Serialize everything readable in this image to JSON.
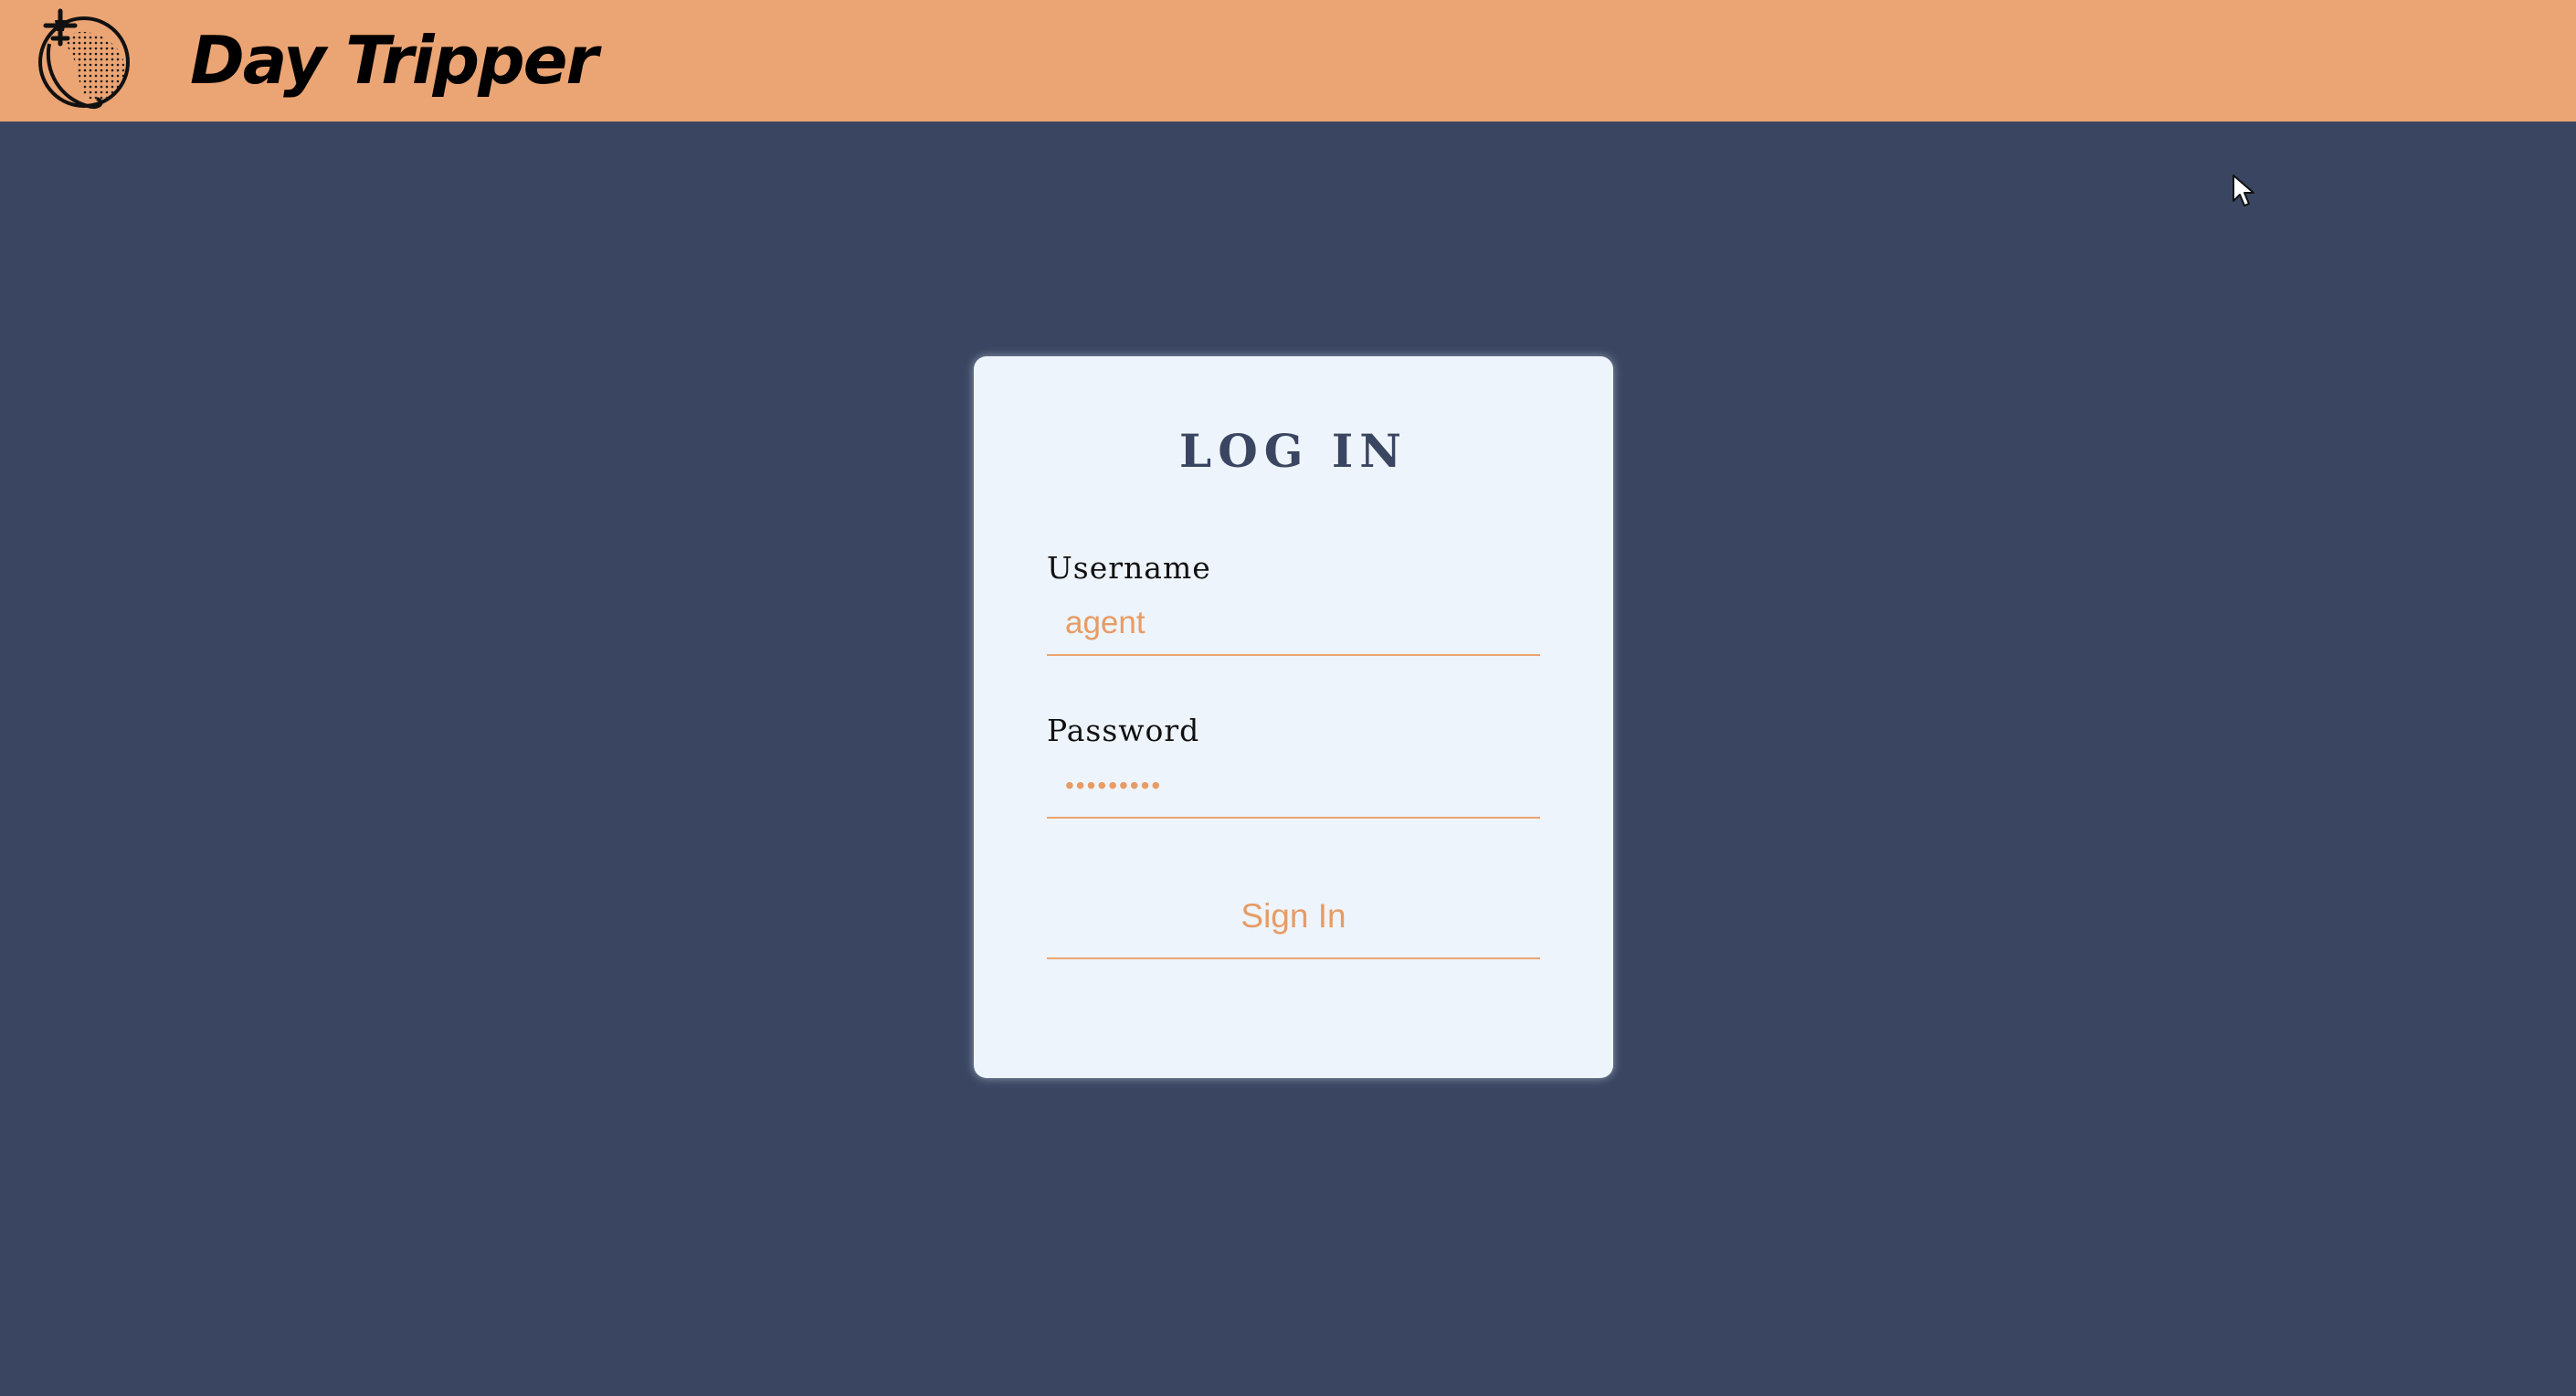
{
  "header": {
    "brand": "Day Tripper",
    "logo_icon": "globe-airplane-icon",
    "background_color": "#eba473"
  },
  "page": {
    "background_color": "#3a4661"
  },
  "login": {
    "title": "LOG IN",
    "username_label": "Username",
    "username_value": "agent",
    "password_label": "Password",
    "password_value": "•••••••••",
    "submit_label": "Sign In",
    "accent_color": "#e69c66"
  }
}
